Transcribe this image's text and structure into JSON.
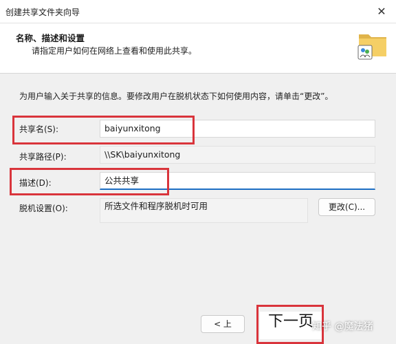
{
  "window": {
    "title": "创建共享文件夹向导",
    "close_icon": "close-icon"
  },
  "header": {
    "heading": "名称、描述和设置",
    "subheading": "请指定用户如何在网络上查看和使用此共享。",
    "icon": "shared-folder-icon"
  },
  "instructions": "为用户输入关于共享的信息。要修改用户在脱机状态下如何使用内容，请单击“更改”。",
  "form": {
    "share_name": {
      "label": "共享名(S):",
      "value": "baiyunxitong"
    },
    "share_path": {
      "label": "共享路径(P):",
      "value": "\\\\SK\\baiyunxitong"
    },
    "description": {
      "label": "描述(D):",
      "value": "公共共享"
    },
    "offline": {
      "label": "脱机设置(O):",
      "value": "所选文件和程序脱机时可用",
      "change_button": "更改(C)..."
    }
  },
  "footer": {
    "back_button": "< 上",
    "next_button": "下一页"
  },
  "watermark": "知乎 @魔法猪",
  "colors": {
    "highlight": "#d9343b",
    "focus_underline": "#1c6ec4"
  }
}
